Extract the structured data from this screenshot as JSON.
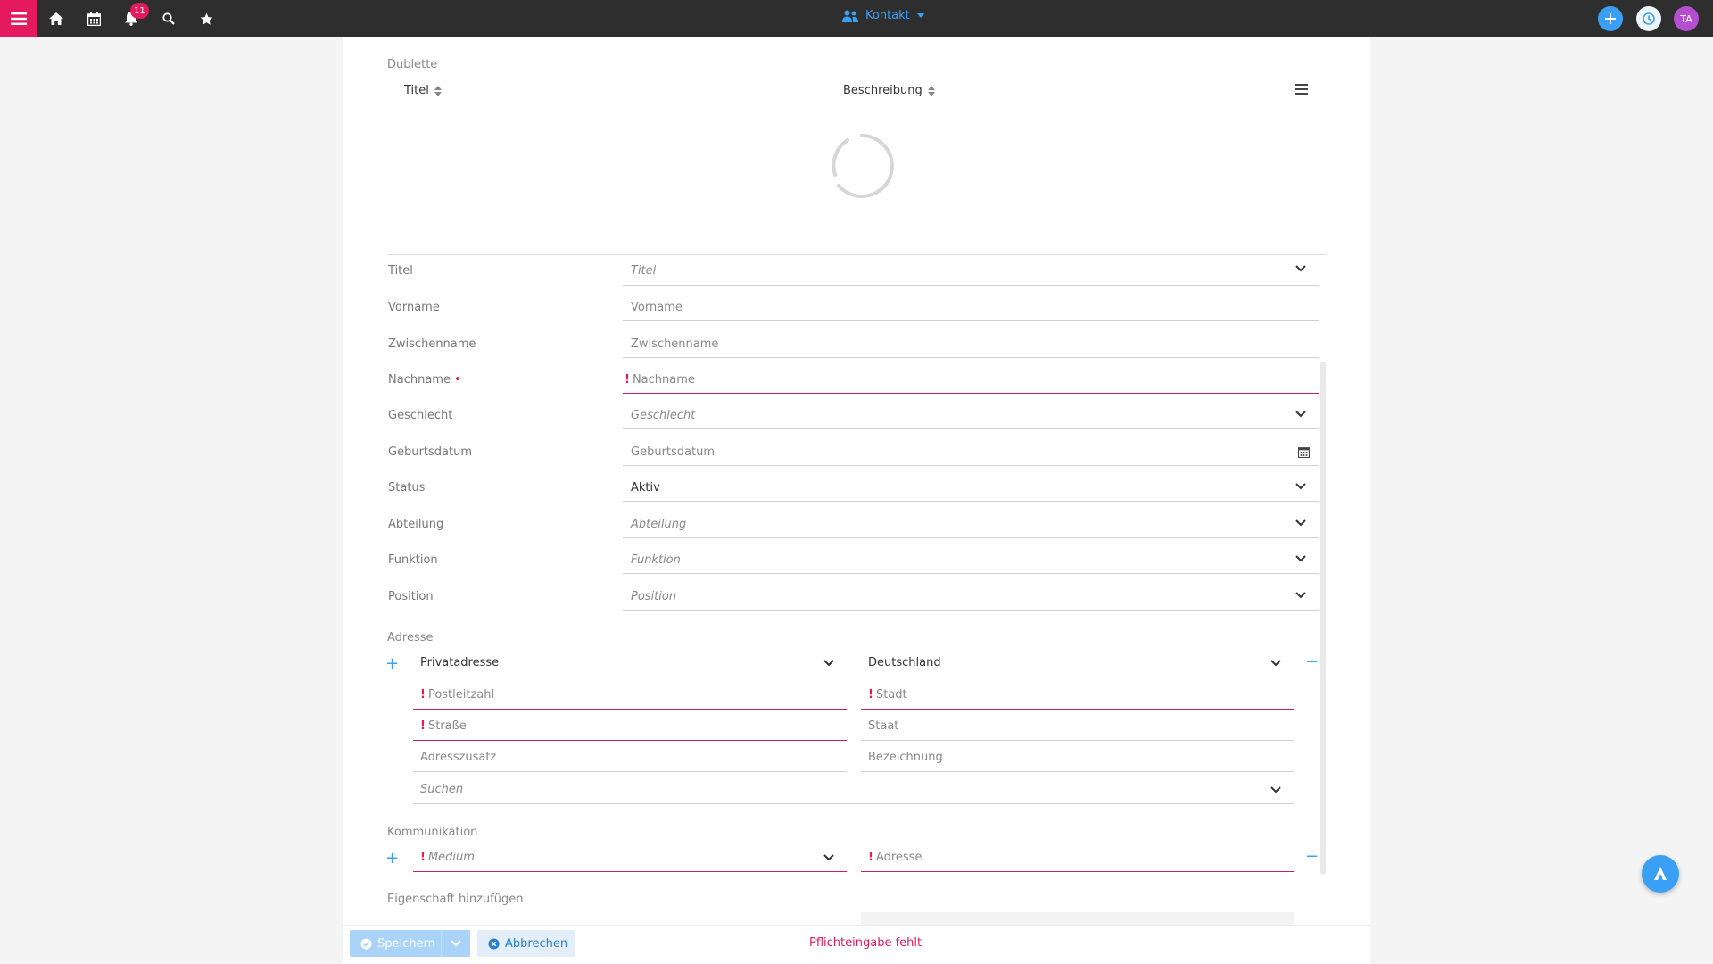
{
  "topbar": {
    "notifications_count": "11",
    "module_label": "Kontakt",
    "avatar_initials": "TA",
    "accent_color": "#e5195e",
    "primary_color": "#3aa0f5"
  },
  "duplicates": {
    "section_label": "Dublette",
    "columns": [
      "Titel",
      "Beschreibung"
    ]
  },
  "form": {
    "rows": [
      {
        "label": "Titel",
        "placeholder": "Titel",
        "type": "select",
        "italic": true
      },
      {
        "label": "Vorname",
        "placeholder": "Vorname",
        "type": "text"
      },
      {
        "label": "Zwischenname",
        "placeholder": "Zwischenname",
        "type": "text"
      },
      {
        "label": "Nachname",
        "placeholder": "Nachname",
        "type": "text",
        "required": true
      },
      {
        "label": "Geschlecht",
        "placeholder": "Geschlecht",
        "type": "select",
        "italic": true
      },
      {
        "label": "Geburtsdatum",
        "placeholder": "Geburtsdatum",
        "type": "date"
      },
      {
        "label": "Status",
        "value": "Aktiv",
        "type": "select"
      },
      {
        "label": "Abteilung",
        "placeholder": "Abteilung",
        "type": "select",
        "italic": true
      },
      {
        "label": "Funktion",
        "placeholder": "Funktion",
        "type": "select",
        "italic": true
      },
      {
        "label": "Position",
        "placeholder": "Position",
        "type": "select",
        "italic": true
      }
    ]
  },
  "address": {
    "section_label": "Adresse",
    "type_value": "Privatadresse",
    "country_value": "Deutschland",
    "postal_code_placeholder": "Postleitzahl",
    "city_placeholder": "Stadt",
    "street_placeholder": "Straße",
    "state_placeholder": "Staat",
    "addition_placeholder": "Adresszusatz",
    "designation_placeholder": "Bezeichnung",
    "search_placeholder": "Suchen"
  },
  "communication": {
    "section_label": "Kommunikation",
    "medium_placeholder": "Medium",
    "address_placeholder": "Adresse"
  },
  "property": {
    "add_label": "Eigenschaft hinzufügen"
  },
  "footer": {
    "save_label": "Speichern",
    "cancel_label": "Abbrechen",
    "error_message": "Pflichteingabe fehlt"
  }
}
